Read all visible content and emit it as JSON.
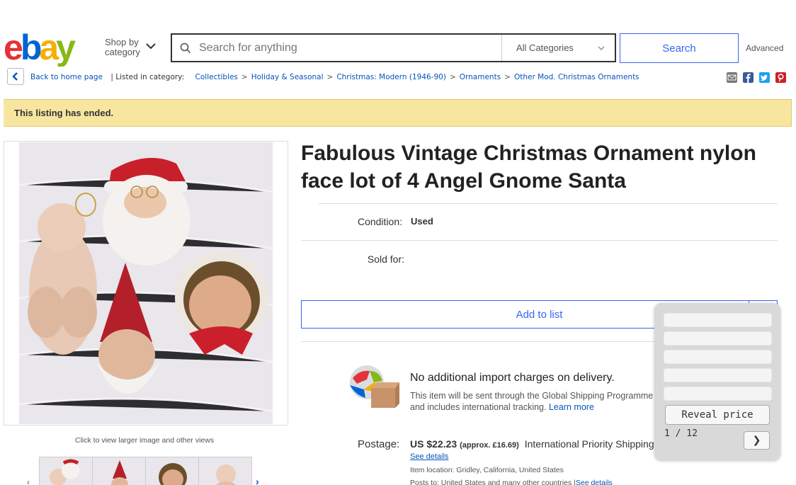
{
  "header": {
    "logo_letters": [
      "e",
      "b",
      "a",
      "y"
    ],
    "logo_colors": [
      "#e53238",
      "#0064d2",
      "#f5af02",
      "#86b817"
    ],
    "shop_by_line1": "Shop by",
    "shop_by_line2": "category",
    "search_placeholder": "Search for anything",
    "category_selected": "All Categories",
    "search_button": "Search",
    "advanced_link": "Advanced"
  },
  "breadcrumb": {
    "back_label": "Back to home page",
    "listed_in": "| Listed in category:",
    "items": [
      "Collectibles",
      "Holiday & Seasonal",
      "Christmas: Modern (1946-90)",
      "Ornaments",
      "Other Mod. Christmas Ornaments"
    ],
    "separator": ">"
  },
  "share_icons": [
    "email-icon",
    "facebook-icon",
    "twitter-icon",
    "pinterest-icon"
  ],
  "banner": {
    "text": "This listing has ended."
  },
  "gallery": {
    "hint": "Click to view larger image and other views",
    "thumbnail_count": 4
  },
  "listing": {
    "title": "Fabulous Vintage Christmas Ornament nylon face lot of 4 Angel Gnome Santa",
    "condition_label": "Condition:",
    "condition_value": "Used",
    "sold_for_label": "Sold for:",
    "add_to_list": "Add to list"
  },
  "import": {
    "title": "No additional import charges on delivery.",
    "desc": "This item will be sent through the Global Shipping Programme and includes international tracking.",
    "learn_more": "Learn more"
  },
  "postage": {
    "label": "Postage:",
    "price": "US $22.23",
    "approx": "(approx. £16.69)",
    "method": "International Priority Shipping",
    "see_details": "See details",
    "item_location": "Item location:  Gridley, California, United States",
    "posts_to": "Posts to:  United States and many other countries |",
    "posts_to_link": "See details"
  },
  "overlay": {
    "field_count": 5,
    "reveal_button": "Reveal price",
    "pager": "1 / 12",
    "next_button": "❯"
  }
}
